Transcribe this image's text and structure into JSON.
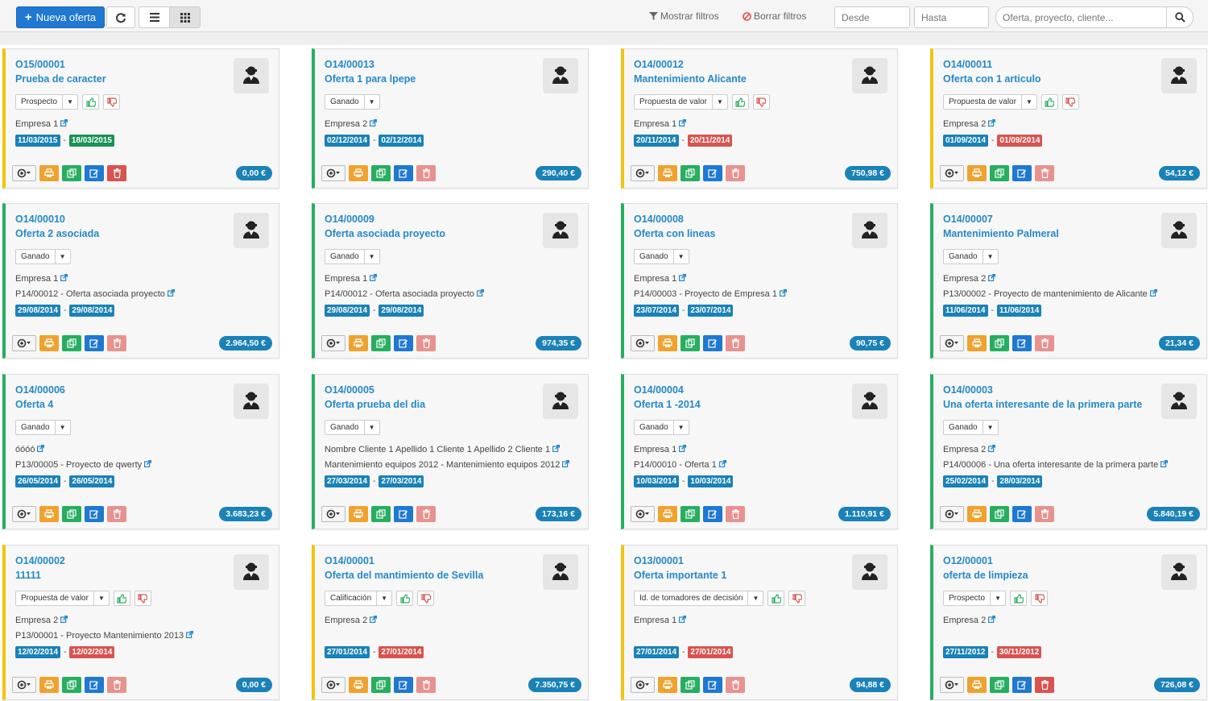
{
  "toolbar": {
    "new_button": "Nueva oferta",
    "show_filters": "Mostrar filtros",
    "clear_filters": "Borrar filtros",
    "from_placeholder": "Desde",
    "to_placeholder": "Hasta",
    "search_placeholder": "Oferta, proyecto, cliente..."
  },
  "colors": {
    "accent": "#1f78d1",
    "won_border": "#27ae60",
    "pending_border": "#f1c40f",
    "amount_badge": "#1a82b7"
  },
  "offers": [
    {
      "code": "O15/00001",
      "title": "Prueba de caracter",
      "stage": "Prospecto",
      "status": "pending",
      "votes": true,
      "client": "Empresa 1",
      "project": "",
      "date_start": "11/03/2015",
      "date_end": "18/03/2015",
      "start_color": "blue",
      "end_color": "green",
      "amount": "0,00 €",
      "delete_light": false
    },
    {
      "code": "O14/00013",
      "title": "Oferta 1 para lpepe",
      "stage": "Ganado",
      "status": "won",
      "votes": false,
      "client": "Empresa 2",
      "project": "",
      "date_start": "02/12/2014",
      "date_end": "02/12/2014",
      "start_color": "blue",
      "end_color": "blue",
      "amount": "290,40 €",
      "delete_light": true
    },
    {
      "code": "O14/00012",
      "title": "Mantenimiento Alicante",
      "stage": "Propuesta de valor",
      "status": "pending",
      "votes": true,
      "client": "Empresa 1",
      "project": "",
      "date_start": "20/11/2014",
      "date_end": "20/11/2014",
      "start_color": "blue",
      "end_color": "red",
      "amount": "750,98 €",
      "delete_light": true
    },
    {
      "code": "O14/00011",
      "title": "Oferta con 1 articulo",
      "stage": "Propuesta de valor",
      "status": "pending",
      "votes": true,
      "client": "Empresa 2",
      "project": "",
      "date_start": "01/09/2014",
      "date_end": "01/09/2014",
      "start_color": "blue",
      "end_color": "red",
      "amount": "54,12 €",
      "delete_light": true
    },
    {
      "code": "O14/00010",
      "title": "Oferta 2 asociada",
      "stage": "Ganado",
      "status": "won",
      "votes": false,
      "client": "Empresa 1",
      "project": "P14/00012 - Oferta asociada proyecto",
      "date_start": "29/08/2014",
      "date_end": "29/08/2014",
      "start_color": "blue",
      "end_color": "blue",
      "amount": "2.964,50 €",
      "delete_light": true
    },
    {
      "code": "O14/00009",
      "title": "Oferta asociada proyecto",
      "stage": "Ganado",
      "status": "won",
      "votes": false,
      "client": "Empresa 1",
      "project": "P14/00012 - Oferta asociada proyecto",
      "date_start": "29/08/2014",
      "date_end": "29/08/2014",
      "start_color": "blue",
      "end_color": "blue",
      "amount": "974,35 €",
      "delete_light": true
    },
    {
      "code": "O14/00008",
      "title": "Oferta con lineas",
      "stage": "Ganado",
      "status": "won",
      "votes": false,
      "client": "Empresa 1",
      "project": "P14/00003 - Proyecto de Empresa 1",
      "date_start": "23/07/2014",
      "date_end": "23/07/2014",
      "start_color": "blue",
      "end_color": "blue",
      "amount": "90,75 €",
      "delete_light": true
    },
    {
      "code": "O14/00007",
      "title": "Mantenimiento Palmeral",
      "stage": "Ganado",
      "status": "won",
      "votes": false,
      "client": "Empresa 2",
      "project": "P13/00002 - Proyecto de mantenimiento de Alicante",
      "date_start": "11/06/2014",
      "date_end": "11/06/2014",
      "start_color": "blue",
      "end_color": "blue",
      "amount": "21,34 €",
      "delete_light": true
    },
    {
      "code": "O14/00006",
      "title": "Oferta 4",
      "stage": "Ganado",
      "status": "won",
      "votes": false,
      "client": "óóóó",
      "project": "P13/00005 - Proyecto de qwerty",
      "date_start": "26/05/2014",
      "date_end": "26/05/2014",
      "start_color": "blue",
      "end_color": "blue",
      "amount": "3.683,23 €",
      "delete_light": true
    },
    {
      "code": "O14/00005",
      "title": "Oferta prueba del dia",
      "stage": "Ganado",
      "status": "won",
      "votes": false,
      "client": "Nombre Cliente 1 Apellido 1 Cliente 1 Apellido 2 Cliente 1",
      "project": "Mantenimiento equipos 2012 - Mantenimiento equipos 2012",
      "date_start": "27/03/2014",
      "date_end": "27/03/2014",
      "start_color": "blue",
      "end_color": "blue",
      "amount": "173,16 €",
      "delete_light": true
    },
    {
      "code": "O14/00004",
      "title": "Oferta 1 -2014",
      "stage": "Ganado",
      "status": "won",
      "votes": false,
      "client": "Empresa 1",
      "project": "P14/00010 - Oferta 1",
      "date_start": "10/03/2014",
      "date_end": "10/03/2014",
      "start_color": "blue",
      "end_color": "blue",
      "amount": "1.110,91 €",
      "delete_light": true
    },
    {
      "code": "O14/00003",
      "title": "Una oferta interesante de la primera parte",
      "stage": "Ganado",
      "status": "won",
      "votes": false,
      "client": "Empresa 2",
      "project": "P14/00006 - Una oferta interesante de la primera parte",
      "date_start": "25/02/2014",
      "date_end": "28/03/2014",
      "start_color": "blue",
      "end_color": "blue",
      "amount": "5.840,19 €",
      "delete_light": true
    },
    {
      "code": "O14/00002",
      "title": "11111",
      "stage": "Propuesta de valor",
      "status": "pending",
      "votes": true,
      "client": "Empresa 2",
      "project": "P13/00001 - Proyecto Mantenimiento 2013",
      "date_start": "12/02/2014",
      "date_end": "12/02/2014",
      "start_color": "blue",
      "end_color": "red",
      "amount": "0,00 €",
      "delete_light": true
    },
    {
      "code": "O14/00001",
      "title": "Oferta del mantimiento de Sevilla",
      "stage": "Calificación",
      "status": "pending",
      "votes": true,
      "client": "Empresa 2",
      "project": "",
      "date_start": "27/01/2014",
      "date_end": "27/01/2014",
      "start_color": "blue",
      "end_color": "red",
      "amount": "7.350,75 €",
      "delete_light": true
    },
    {
      "code": "O13/00001",
      "title": "Oferta importante 1",
      "stage": "Id. de tomadores de decisión",
      "status": "pending",
      "votes": true,
      "client": "Empresa 1",
      "project": "",
      "date_start": "27/01/2014",
      "date_end": "27/01/2014",
      "start_color": "blue",
      "end_color": "red",
      "amount": "94,88 €",
      "delete_light": true
    },
    {
      "code": "O12/00001",
      "title": "oferta de limpieza",
      "stage": "Prospecto",
      "status": "won",
      "votes": true,
      "client": "Empresa 2",
      "project": "",
      "date_start": "27/11/2012",
      "date_end": "30/11/2012",
      "start_color": "blue",
      "end_color": "red",
      "amount": "726,08 €",
      "delete_light": false
    }
  ]
}
